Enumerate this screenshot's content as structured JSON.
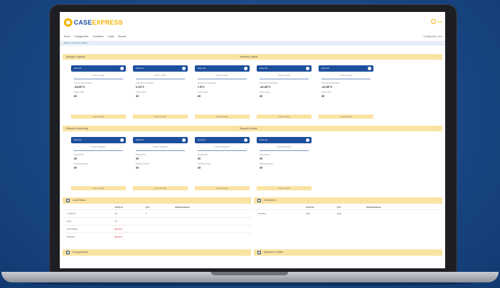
{
  "app": {
    "logo_main": "CASE",
    "logo_accent": "EXPRESS",
    "user_label": "Info",
    "nav_right": "Configuration | Info"
  },
  "nav": [
    "Home",
    "Consignments",
    "Containers",
    "Loads",
    "Reports"
  ],
  "breadcrumb": "Home > Inventory Status",
  "section1": {
    "title": "Storage Capacity",
    "mid": "Inventory Status"
  },
  "cards1": [
    {
      "head": "Zone 01",
      "sub": "Active Loads",
      "lbl": "Current Temperature",
      "val": "-18.90°C",
      "lbl2": "Total Loads",
      "val2": "40",
      "btn": "View Details"
    },
    {
      "head": "Zone 02",
      "sub": "Active Loads",
      "lbl": "Current Temperature",
      "val": "0.10°C",
      "lbl2": "Total Loads",
      "val2": "40",
      "btn": "View Details"
    },
    {
      "head": "Zone 03",
      "sub": "Active Loads",
      "lbl": "Current Temperature",
      "val": "7.8°C",
      "lbl2": "Total Loads",
      "val2": "40",
      "btn": "View Details"
    },
    {
      "head": "Zone 04",
      "sub": "Active Loads",
      "lbl": "Current Temperature",
      "val": "-22.40°C",
      "lbl2": "Total Loads",
      "val2": "40",
      "btn": "View Details"
    },
    {
      "head": "Zone 05",
      "sub": "Active Loads",
      "lbl": "Current Temperature",
      "val": "-11.50°C",
      "lbl2": "Total Loads",
      "val2": "40",
      "btn": "View Details"
    }
  ],
  "section2": {
    "title": "Dispatch Monitoring",
    "mid": "Dispatch Status"
  },
  "cards2": [
    {
      "head": "Dock 01",
      "sub": "Active Dispatch",
      "lbl": "Dispatched",
      "val": "40",
      "lbl2": "Pending Orders",
      "val2": "40",
      "btn": "View Details"
    },
    {
      "head": "Dock 02",
      "sub": "Active Dispatch",
      "lbl": "Dispatched",
      "val": "40",
      "lbl2": "Pending Orders",
      "val2": "40",
      "btn": "View Details"
    },
    {
      "head": "Dock 03",
      "sub": "Active Dispatch",
      "lbl": "Dispatched",
      "val": "40",
      "lbl2": "Pending Orders",
      "val2": "40",
      "btn": "View Details"
    },
    {
      "head": "Dock 04",
      "sub": "Active Dispatch",
      "lbl": "Dispatched",
      "val": "40",
      "lbl2": "Pending Orders",
      "val2": "40",
      "btn": "View Details"
    }
  ],
  "panel_left": {
    "title": "Load Status",
    "cols": [
      "STATUS",
      "QTY",
      "PERCENTAGE"
    ],
    "rows": [
      {
        "name": "In Transit",
        "status": "10",
        "qty": "0"
      },
      {
        "name": "Held",
        "status": "10",
        "qty": ""
      },
      {
        "name": "Not Packed",
        "status": "Blocked",
        "qty": ""
      },
      {
        "name": "Shipped",
        "status": "Blocked",
        "qty": ""
      }
    ]
  },
  "panel_right": {
    "title": "Containers",
    "cols": [
      "STATUS",
      "QTY",
      "PERCENTAGE"
    ],
    "rows": [
      {
        "name": "Pending",
        "status": "Hold",
        "qty": "Hold"
      }
    ]
  },
  "panel_bottom_left": {
    "title": "Consignments"
  },
  "panel_bottom_right": {
    "title": "Shipment Tracker"
  }
}
